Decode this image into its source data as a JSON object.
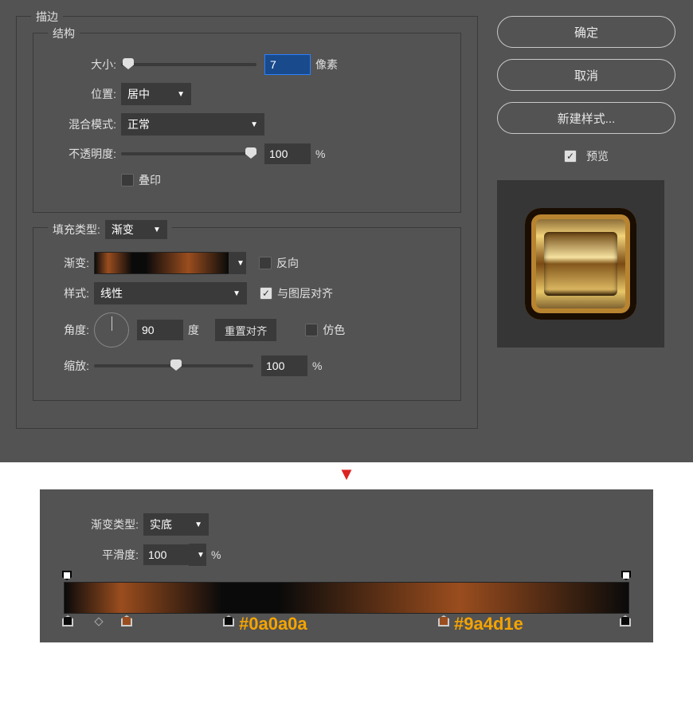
{
  "panel": {
    "title": "描边",
    "structure_title": "结构",
    "size_label": "大小:",
    "size_value": "7",
    "size_unit": "像素",
    "position_label": "位置:",
    "position_value": "居中",
    "blend_label": "混合模式:",
    "blend_value": "正常",
    "opacity_label": "不透明度:",
    "opacity_value": "100",
    "opacity_unit": "%",
    "overprint_label": "叠印",
    "fill_title": "填充类型:",
    "fill_value": "渐变",
    "gradient_label": "渐变:",
    "reverse_label": "反向",
    "style_label": "样式:",
    "style_value": "线性",
    "align_label": "与图层对齐",
    "angle_label": "角度:",
    "angle_value": "90",
    "angle_unit": "度",
    "reset_align": "重置对齐",
    "dither_label": "仿色",
    "scale_label": "缩放:",
    "scale_value": "100",
    "scale_unit": "%"
  },
  "buttons": {
    "ok": "确定",
    "cancel": "取消",
    "new_style": "新建样式...",
    "preview": "预览"
  },
  "grad_editor": {
    "type_label": "渐变类型:",
    "type_value": "实底",
    "smooth_label": "平滑度:",
    "smooth_value": "100",
    "smooth_unit": "%",
    "hex1": "#0a0a0a",
    "hex2": "#9a4d1e",
    "stops": [
      {
        "pos": 0,
        "color": "#0a0a0a"
      },
      {
        "pos": 10,
        "color": "#9a4d1e"
      },
      {
        "pos": 30,
        "color": "#0a0a0a"
      },
      {
        "pos": 70,
        "color": "#9a4d1e"
      },
      {
        "pos": 100,
        "color": "#0a0a0a"
      }
    ]
  }
}
